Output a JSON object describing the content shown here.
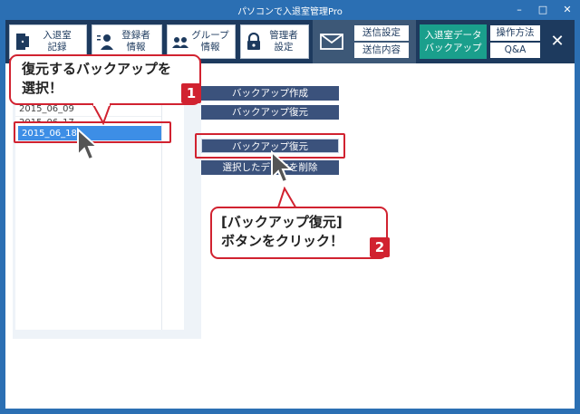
{
  "window": {
    "title": "パソコンで入退室管理Pro",
    "controls": {
      "minimize": "–",
      "maximize": "□",
      "close": "✕"
    }
  },
  "toolbar": {
    "entry_exit_record": [
      "入退室",
      "記録"
    ],
    "registrant_info": [
      "登録者",
      "情報"
    ],
    "group_info": [
      "グループ",
      "情報"
    ],
    "admin_settings": [
      "管理者",
      "設定"
    ],
    "mail": {
      "send_settings": "送信設定",
      "send_content": "送信内容"
    },
    "backup": [
      "入退室データ",
      "バックアップ"
    ],
    "help": {
      "manual": "操作方法",
      "qa": "Q&A"
    },
    "close": "✕"
  },
  "backup_list": {
    "rows": [
      "2015_06_09",
      "2015_06_17",
      "2015_06_18"
    ],
    "selected_index": 2
  },
  "actions": {
    "create": "バックアップ作成",
    "restore_top": "バックアップ復元",
    "restore": "バックアップ復元",
    "delete": "選択したデータを削除"
  },
  "callouts": {
    "step1": {
      "lines": [
        "復元するバックアップを",
        "選択！"
      ],
      "number": "1"
    },
    "step2": {
      "lines": [
        "[バックアップ復元]",
        "ボタンをクリック！"
      ],
      "number": "2"
    }
  },
  "colors": {
    "title_bar": "#2b6fb3",
    "toolbar_bg": "#1d3a5e",
    "backup_accent": "#1a9f8c",
    "action_button": "#3b527c",
    "callout_red": "#d12230",
    "selection": "#3d8ee6"
  }
}
